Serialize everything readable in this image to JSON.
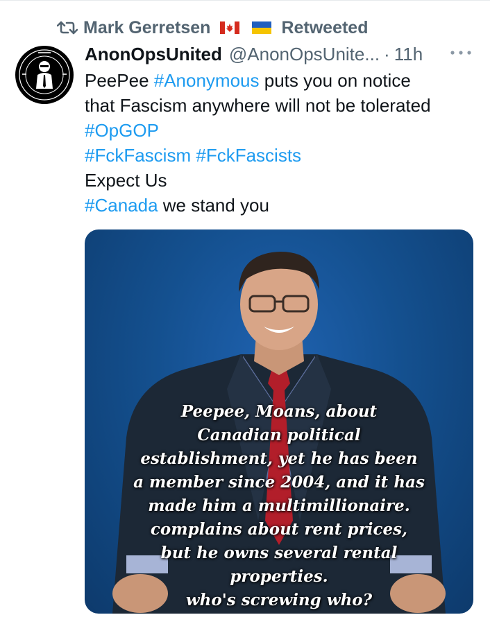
{
  "retweet": {
    "icon": "retweet-icon",
    "user": "Mark Gerretsen",
    "flags": [
      "canada-flag-icon",
      "ukraine-flag-icon"
    ],
    "label": "Retweeted"
  },
  "tweet": {
    "display_name": "AnonOpsUnited",
    "handle": "@AnonOpsUnite...",
    "separator": "·",
    "time": "11h",
    "more_icon": "more-horizontal-icon",
    "lines": {
      "l1_a": "PeePee ",
      "l1_tag": "#Anonymous",
      "l1_b": " puts you on notice",
      "l2": "that Fascism anywhere will not be tolerated",
      "l3_tag": "#OpGOP",
      "l4_tag1": "#FckFascism",
      "l4_tag2": "#FckFascists",
      "l5": "Expect Us",
      "l6_tag": "#Canada",
      "l6_b": " we stand you"
    }
  },
  "media": {
    "meme_lines": [
      "Peepee, Moans, about",
      "Canadian political",
      "establishment, yet he has been",
      "a member since 2004, and it has",
      "made him a multimillionaire.",
      "complains about rent prices,",
      "but he owns several rental",
      "properties.",
      "who's screwing who?"
    ]
  },
  "colors": {
    "link": "#1d9bf0",
    "muted": "#536471",
    "text": "#0f1419",
    "media_bg": "#14508f"
  }
}
